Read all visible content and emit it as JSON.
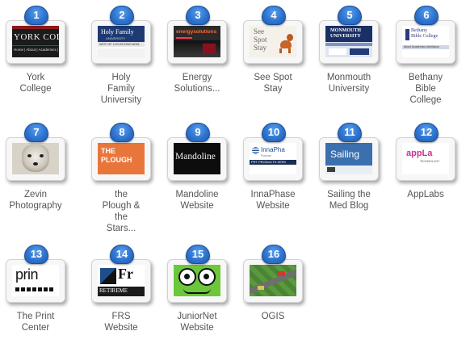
{
  "items": [
    {
      "num": "1",
      "label": "York\nCollege"
    },
    {
      "num": "2",
      "label": "Holy\nFamily\nUniversity"
    },
    {
      "num": "3",
      "label": "Energy\nSolutions..."
    },
    {
      "num": "4",
      "label": "See Spot\nStay"
    },
    {
      "num": "5",
      "label": "Monmouth\nUniversity"
    },
    {
      "num": "6",
      "label": "Bethany\nBible\nCollege"
    },
    {
      "num": "7",
      "label": "Zevin\nPhotography"
    },
    {
      "num": "8",
      "label": "the\nPlough &\nthe\nStars..."
    },
    {
      "num": "9",
      "label": "Mandoline\nWebsite"
    },
    {
      "num": "10",
      "label": "InnaPhase\nWebsite"
    },
    {
      "num": "11",
      "label": "Sailing the\nMed Blog"
    },
    {
      "num": "12",
      "label": "AppLabs"
    },
    {
      "num": "13",
      "label": "The Print\nCenter"
    },
    {
      "num": "14",
      "label": "FRS\nWebsite"
    },
    {
      "num": "15",
      "label": "JuniorNet\nWebsite"
    },
    {
      "num": "16",
      "label": "OGIS"
    }
  ],
  "thumbnails": {
    "york": {
      "logo": "YORK COLLE",
      "nav": "Home | About | Academics |"
    },
    "holy": {
      "logo": "Holy Family",
      "sub": "UNIVERSITY",
      "nav": "WHY HF   LOCATIONS   ADM"
    },
    "energy": {
      "logo": "energysolutions"
    },
    "spot": {
      "logo": "See\nSpot\nStay"
    },
    "monmouth": {
      "logo": "MONMOUTH\nUNIVERSITY"
    },
    "bethany": {
      "logo": "Bethany\nBible College",
      "nav": "About  Academics  Admission"
    },
    "plough": {
      "logo": "THE\nPLOUGH"
    },
    "mandoline": {
      "logo": "Mandoline"
    },
    "inna": {
      "logo": "InnaPha",
      "sub": "Purpose",
      "nav": "PRT   PRODUCTS   SERV"
    },
    "sailing": {
      "logo": "Sailing"
    },
    "applabs": {
      "logo": "appLa",
      "sub": "TECHNOLOGY"
    },
    "print": {
      "logo": "prin"
    },
    "frs": {
      "logo": "Fr",
      "sub": "RETIREME"
    }
  },
  "colors": {
    "badge": "#2e74cf",
    "label": "#555555",
    "york_bg": "#1b1b1b",
    "holy_bg": "#1d3a73",
    "plough_bg": "#e8763a",
    "inna_blue": "#1f4f9a",
    "sailing_bg": "#3b6fae",
    "applabs_pink": "#c8328d",
    "junior_green": "#6cc73b"
  }
}
